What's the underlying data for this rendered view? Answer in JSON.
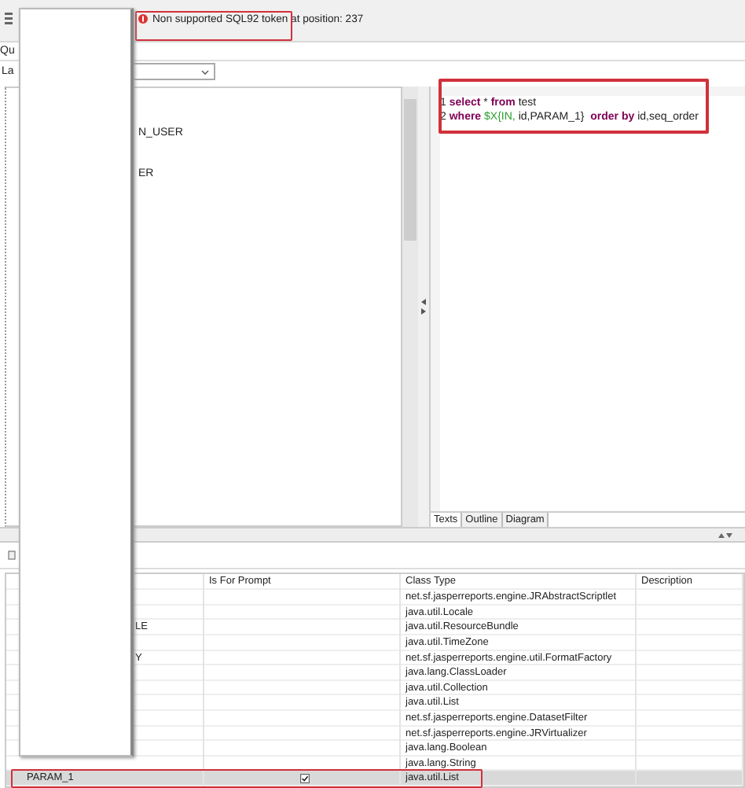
{
  "status_message": {
    "text": "Non supported SQL92 token at position: 237",
    "highlighted": true
  },
  "tab": {
    "label": "Qu"
  },
  "language": {
    "label": "La"
  },
  "tree": {
    "items": [
      {
        "label": "N_USER"
      },
      {
        "label": "ER"
      }
    ]
  },
  "editor": {
    "highlighted": true,
    "lines": [
      {
        "number": "1",
        "tokens": [
          {
            "text": "select",
            "kind": "keyword"
          },
          {
            "text": " * ",
            "kind": "plain"
          },
          {
            "text": "from",
            "kind": "keyword"
          },
          {
            "text": " test",
            "kind": "plain"
          }
        ]
      },
      {
        "number": "2",
        "tokens": [
          {
            "text": "where",
            "kind": "keyword"
          },
          {
            "text": " $X{IN,",
            "kind": "param"
          },
          {
            "text": " id,PARAM_1}  ",
            "kind": "plain"
          },
          {
            "text": "order by",
            "kind": "keyword"
          },
          {
            "text": " id,seq_order",
            "kind": "plain"
          }
        ]
      }
    ],
    "tabs": [
      {
        "label": "Texts",
        "selected": true
      },
      {
        "label": "Outline",
        "selected": false
      },
      {
        "label": "Diagram",
        "selected": false
      }
    ]
  },
  "table": {
    "columns": [
      "Is For Prompt",
      "Class Type",
      "Description"
    ],
    "rows": [
      {
        "prompt": false,
        "class_type": "net.sf.jasperreports.engine.JRAbstractScriptlet",
        "selected": false
      },
      {
        "prompt": false,
        "class_type": "java.util.Locale",
        "selected": false
      },
      {
        "name": "LE",
        "prompt": false,
        "class_type": "java.util.ResourceBundle",
        "selected": false
      },
      {
        "prompt": false,
        "class_type": "java.util.TimeZone",
        "selected": false
      },
      {
        "name": "Y",
        "prompt": false,
        "class_type": "net.sf.jasperreports.engine.util.FormatFactory",
        "selected": false
      },
      {
        "prompt": false,
        "class_type": "java.lang.ClassLoader",
        "selected": false
      },
      {
        "prompt": false,
        "class_type": "java.util.Collection",
        "selected": false
      },
      {
        "prompt": false,
        "class_type": "java.util.List",
        "selected": false
      },
      {
        "prompt": false,
        "class_type": "net.sf.jasperreports.engine.DatasetFilter",
        "selected": false
      },
      {
        "prompt": false,
        "class_type": "net.sf.jasperreports.engine.JRVirtualizer",
        "selected": false
      },
      {
        "prompt": false,
        "class_type": "java.lang.Boolean",
        "selected": false
      },
      {
        "prompt": false,
        "class_type": "java.lang.String",
        "selected": false
      },
      {
        "name": "PARAM_1",
        "prompt": true,
        "class_type": "java.util.List",
        "selected": true,
        "highlighted": true
      }
    ]
  }
}
